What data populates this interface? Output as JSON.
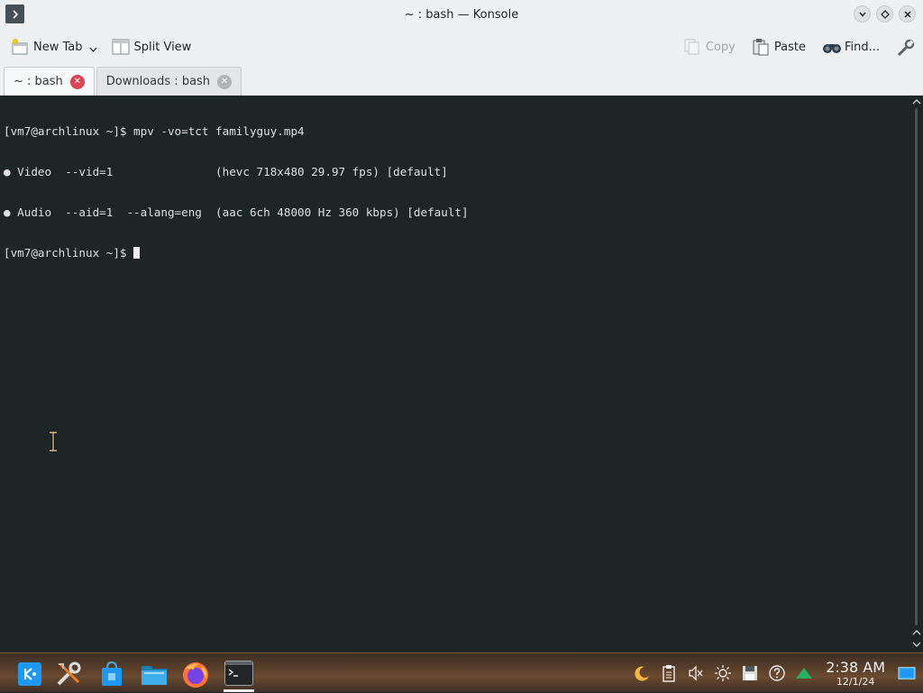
{
  "window": {
    "title": "~ : bash — Konsole",
    "controls": {
      "minimize_icon": "chevron-down",
      "maximize_icon": "diamond",
      "close_icon": "x"
    }
  },
  "toolbar": {
    "new_tab_label": "New Tab",
    "split_view_label": "Split View",
    "copy_label": "Copy",
    "paste_label": "Paste",
    "find_label": "Find..."
  },
  "tabs": [
    {
      "label": "~ : bash",
      "active": true
    },
    {
      "label": "Downloads : bash",
      "active": false
    }
  ],
  "terminal": {
    "lines": [
      "[vm7@archlinux ~]$ mpv -vo=tct familyguy.mp4",
      "● Video  --vid=1               (hevc 718x480 29.97 fps) [default]",
      "● Audio  --aid=1  --alang=eng  (aac 6ch 48000 Hz 360 kbps) [default]",
      "[vm7@archlinux ~]$ "
    ]
  },
  "taskbar": {
    "launchers": [
      "kde-application-launcher",
      "system-settings",
      "discover-store",
      "dolphin-file-manager",
      "firefox",
      "konsole"
    ],
    "clock_time": "2:38 AM",
    "clock_date": "12/1/24",
    "tray_icons": [
      "night-color",
      "clipboard",
      "volume-muted",
      "brightness",
      "save-disk",
      "help",
      "network-up",
      "show-desktop"
    ]
  },
  "colors": {
    "terminal_bg": "#1e2625",
    "terminal_fg": "#dde0df",
    "tab_close_active": "#da4453",
    "window_bg": "#eff0f1"
  }
}
